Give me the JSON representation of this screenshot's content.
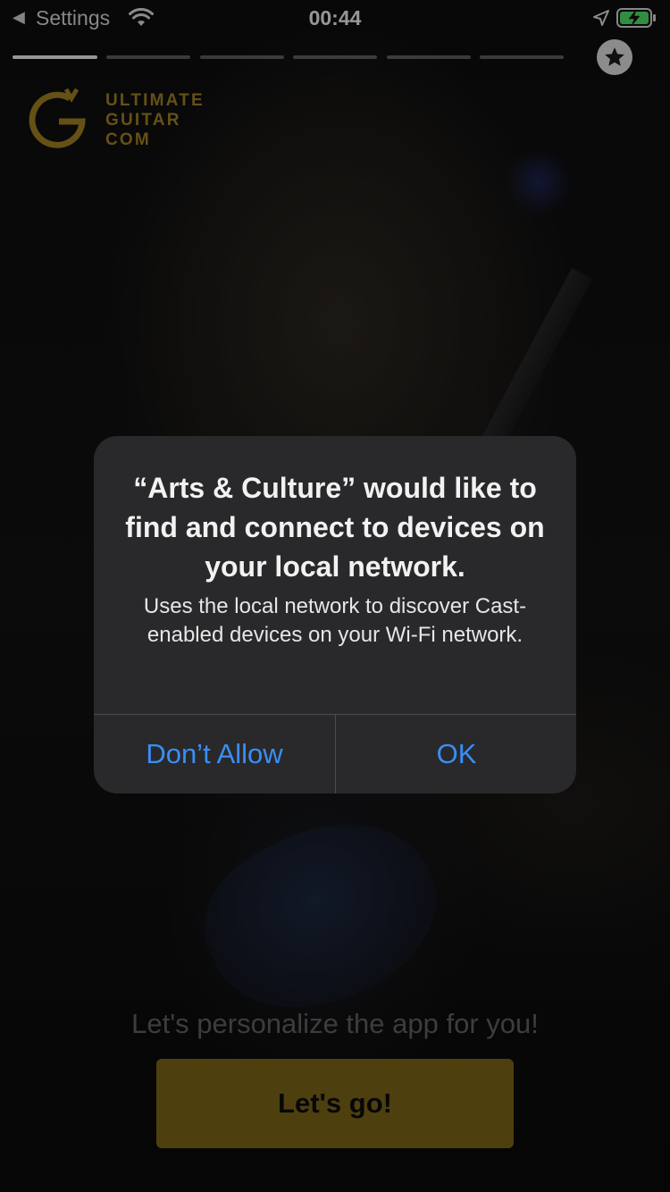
{
  "status_bar": {
    "back_label": "Settings",
    "time": "00:44",
    "icons": [
      "back-arrow-icon",
      "wifi-icon",
      "location-arrow-icon",
      "battery-charging-icon"
    ]
  },
  "stories": {
    "segment_count": 6,
    "active_index": 0,
    "icon": "star-icon"
  },
  "logo": {
    "line1": "ULTIMATE",
    "line2": "GUITAR",
    "line3": "COM",
    "brand_color": "#9c7d23"
  },
  "onboarding": {
    "tagline": "Let's personalize the app for you!",
    "cta_label": "Let's go!",
    "cta_color": "#786118"
  },
  "alert": {
    "title": "“Arts & Culture” would like to find and connect to devices on your local network.",
    "message": "Uses the local network to discover Cast-enabled devices on your Wi-Fi network.",
    "deny_label": "Don’t Allow",
    "ok_label": "OK",
    "button_color": "#3a8ef6"
  }
}
